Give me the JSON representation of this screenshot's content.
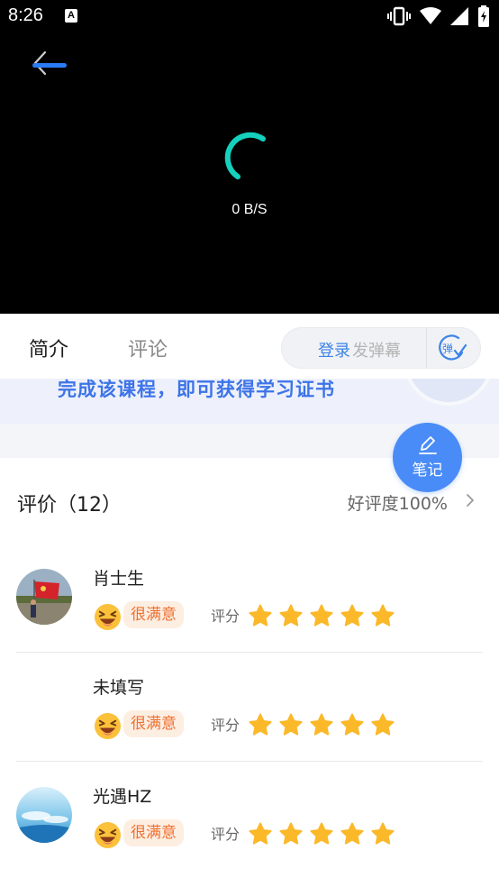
{
  "status_bar": {
    "time": "8:26",
    "notification_letter": "A"
  },
  "player": {
    "speed": "0 B/S"
  },
  "tabs": [
    {
      "label": "简介",
      "active": true
    },
    {
      "label": "评论",
      "active": false
    }
  ],
  "danmu": {
    "login": "登录",
    "send_placeholder": "发弹幕",
    "toggle_label": "弹"
  },
  "banner": {
    "text": "完成该课程，即可获得学习证书"
  },
  "note_button": {
    "label": "笔记"
  },
  "reviews": {
    "title": "评价（12）",
    "positive_rate": "好评度100%",
    "items": [
      {
        "name": "肖士生",
        "satisfaction": "很满意",
        "score_label": "评分",
        "stars": 5
      },
      {
        "name": "未填写",
        "satisfaction": "很满意",
        "score_label": "评分",
        "stars": 5
      },
      {
        "name": "光遇HZ",
        "satisfaction": "很满意",
        "score_label": "评分",
        "stars": 5
      }
    ]
  },
  "colors": {
    "accent": "#2a7cf6",
    "star": "#fbb829",
    "satisfaction_text": "#ee7030",
    "spinner": "#14d1bd"
  }
}
